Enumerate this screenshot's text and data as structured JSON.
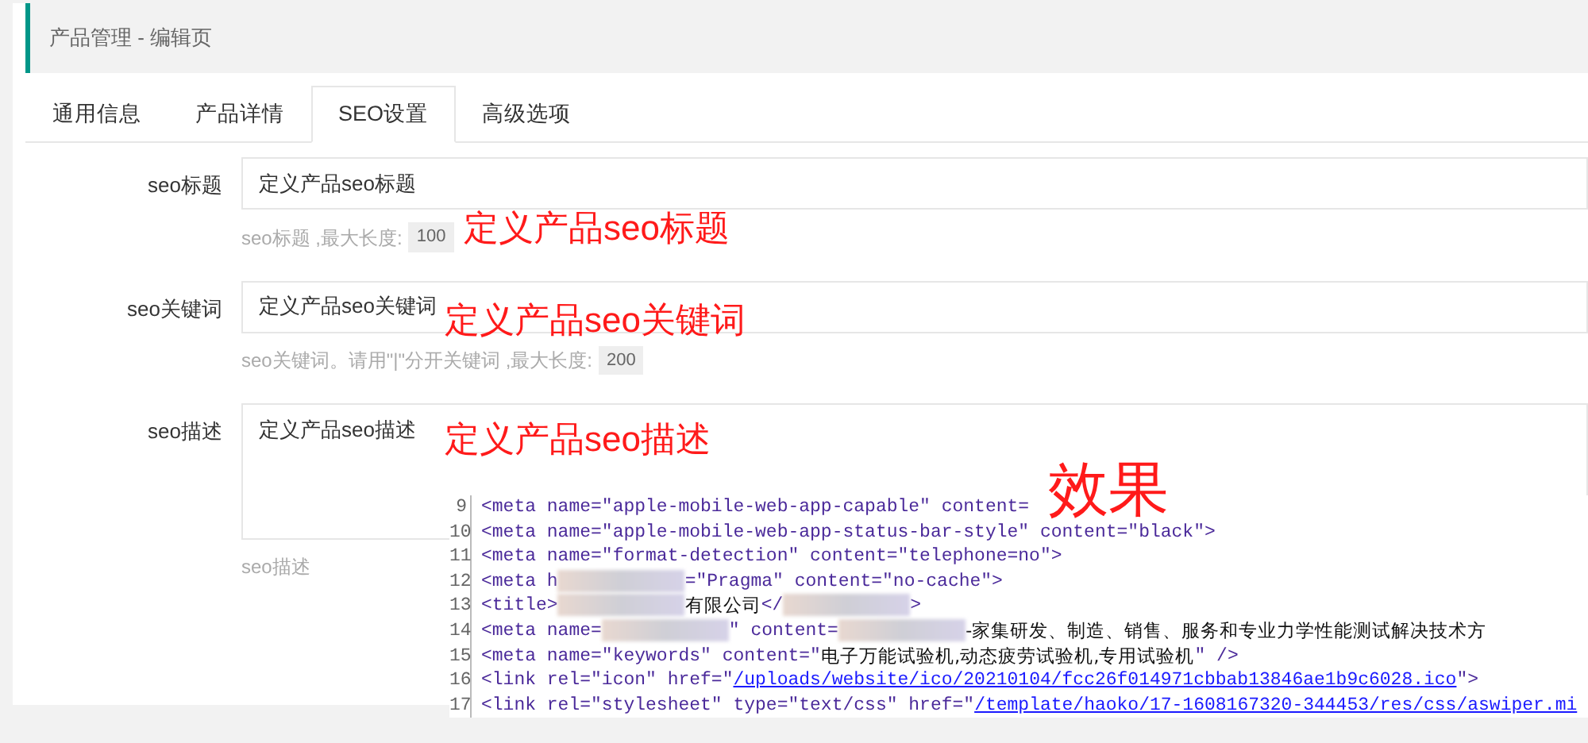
{
  "page_header": {
    "title": "产品管理 - 编辑页"
  },
  "tabs": [
    {
      "label": "通用信息",
      "selected": false
    },
    {
      "label": "产品详情",
      "selected": false
    },
    {
      "label": "SEO设置",
      "selected": true
    },
    {
      "label": "高级选项",
      "selected": false
    }
  ],
  "fields": [
    {
      "kind": "input",
      "label": "seo标题",
      "value": "定义产品seo标题",
      "help": "seo标题 ,最大长度:",
      "limit": "100"
    },
    {
      "kind": "input",
      "label": "seo关键词",
      "value": "定义产品seo关键词",
      "help": "seo关键词。请用\"|\"分开关键词 ,最大长度:",
      "limit": "200"
    },
    {
      "kind": "textarea",
      "label": "seo描述",
      "value": "定义产品seo描述",
      "help": "seo描述"
    }
  ],
  "annotations": [
    {
      "text": "定义产品seo标题"
    },
    {
      "text": "定义产品seo关键词"
    },
    {
      "text": "定义产品seo描述"
    },
    {
      "text": "效果"
    }
  ],
  "code_preview": {
    "lines": [
      {
        "number": "9",
        "segments": [
          {
            "kind": "code",
            "text": "<meta name=\"apple-mobile-web-app-capable\" content="
          }
        ]
      },
      {
        "number": "10",
        "segments": [
          {
            "kind": "code",
            "text": "<meta name=\"apple-mobile-web-app-status-bar-style\" content=\"black\">"
          }
        ]
      },
      {
        "number": "11",
        "segments": [
          {
            "kind": "code",
            "text": "<meta name=\"format-detection\" content=\"telephone=no\">"
          }
        ]
      },
      {
        "number": "12",
        "segments": [
          {
            "kind": "code",
            "text": "<meta h"
          },
          {
            "kind": "blur"
          },
          {
            "kind": "code",
            "text": "=\"Pragma\" content=\"no-cache\">"
          }
        ]
      },
      {
        "number": "13",
        "segments": [
          {
            "kind": "code",
            "text": "<title>"
          },
          {
            "kind": "blur"
          },
          {
            "kind": "text",
            "text": "有限公司"
          },
          {
            "kind": "code",
            "text": "</"
          },
          {
            "kind": "blur"
          },
          {
            "kind": "code",
            "text": ">"
          }
        ]
      },
      {
        "number": "14",
        "segments": [
          {
            "kind": "code",
            "text": "<meta name="
          },
          {
            "kind": "blur"
          },
          {
            "kind": "code",
            "text": "\" content="
          },
          {
            "kind": "blur"
          },
          {
            "kind": "text",
            "text": "-家集研发、制造、销售、服务和专业力学性能测试解决技术方"
          }
        ]
      },
      {
        "number": "15",
        "segments": [
          {
            "kind": "code",
            "text": "<meta name=\"keywords\" content=\""
          },
          {
            "kind": "text",
            "text": "电子万能试验机,动态疲劳试验机,专用试验机"
          },
          {
            "kind": "code",
            "text": "\" />"
          }
        ]
      },
      {
        "number": "16",
        "segments": [
          {
            "kind": "code",
            "text": "<link rel=\"icon\" href=\""
          },
          {
            "kind": "link",
            "text": "/uploads/website/ico/20210104/fcc26f014971cbbab13846ae1b9c6028.ico"
          },
          {
            "kind": "code",
            "text": "\">"
          }
        ]
      },
      {
        "number": "17",
        "segments": [
          {
            "kind": "code",
            "text": "<link rel=\"stylesheet\" type=\"text/css\" href=\""
          },
          {
            "kind": "link",
            "text": "/template/haoko/17-1608167320-344453/res/css/aswiper.mi"
          }
        ]
      }
    ]
  }
}
